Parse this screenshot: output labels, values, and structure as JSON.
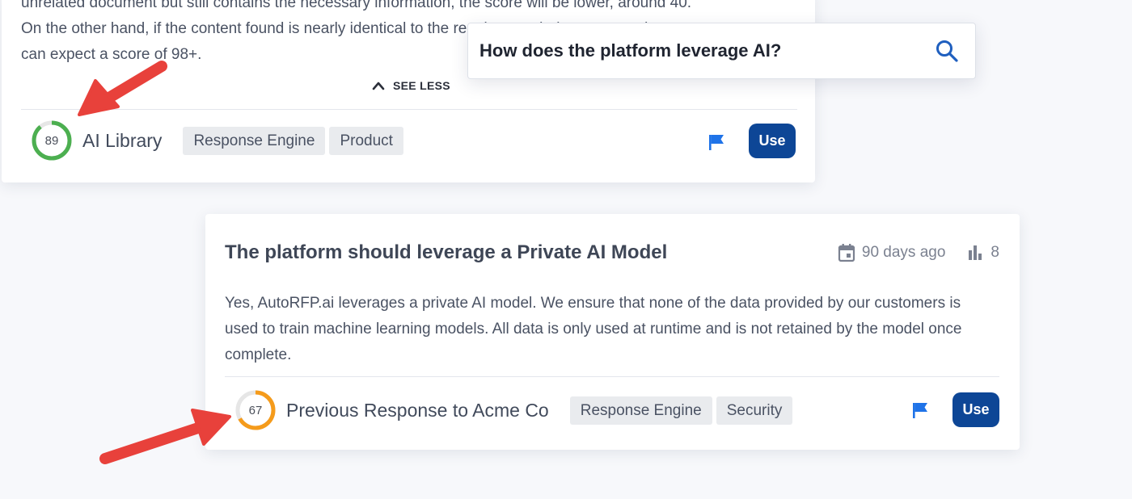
{
  "search": {
    "query": "How does the platform leverage AI?"
  },
  "card1": {
    "body_lines": [
      "unrelated document but still contains the necessary information, the score will be lower, around 40.",
      "On the other hand, if the content found is nearly identical to the requirement being answered, you",
      "can expect a score of 98+."
    ],
    "see_less_label": "SEE LESS",
    "score": "89",
    "score_value": 89,
    "source": "AI Library",
    "tags": [
      "Response Engine",
      "Product"
    ],
    "use_label": "Use"
  },
  "card2": {
    "title": "The platform should leverage a Private AI Model",
    "age": "90 days ago",
    "usage_count": "8",
    "answer": "Yes, AutoRFP.ai leverages a private AI model. We ensure that none of the data provided by our customers is used to train machine learning models. All data is only used at runtime and is not retained by the model once complete.",
    "score": "67",
    "score_value": 67,
    "source": "Previous Response to Acme Co",
    "tags": [
      "Response Engine",
      "Security"
    ],
    "use_label": "Use"
  },
  "colors": {
    "score_high": "#4caf50",
    "score_mid": "#f59b1b",
    "score_track": "#e6e6e6",
    "primary": "#0d4696",
    "flag": "#1f73e8",
    "arrow": "#e8413b"
  },
  "icons": {
    "see_less": "chevron-up-icon",
    "flag": "flag-icon",
    "date": "calendar-icon",
    "usage": "bar-chart-icon",
    "search": "search-icon"
  }
}
